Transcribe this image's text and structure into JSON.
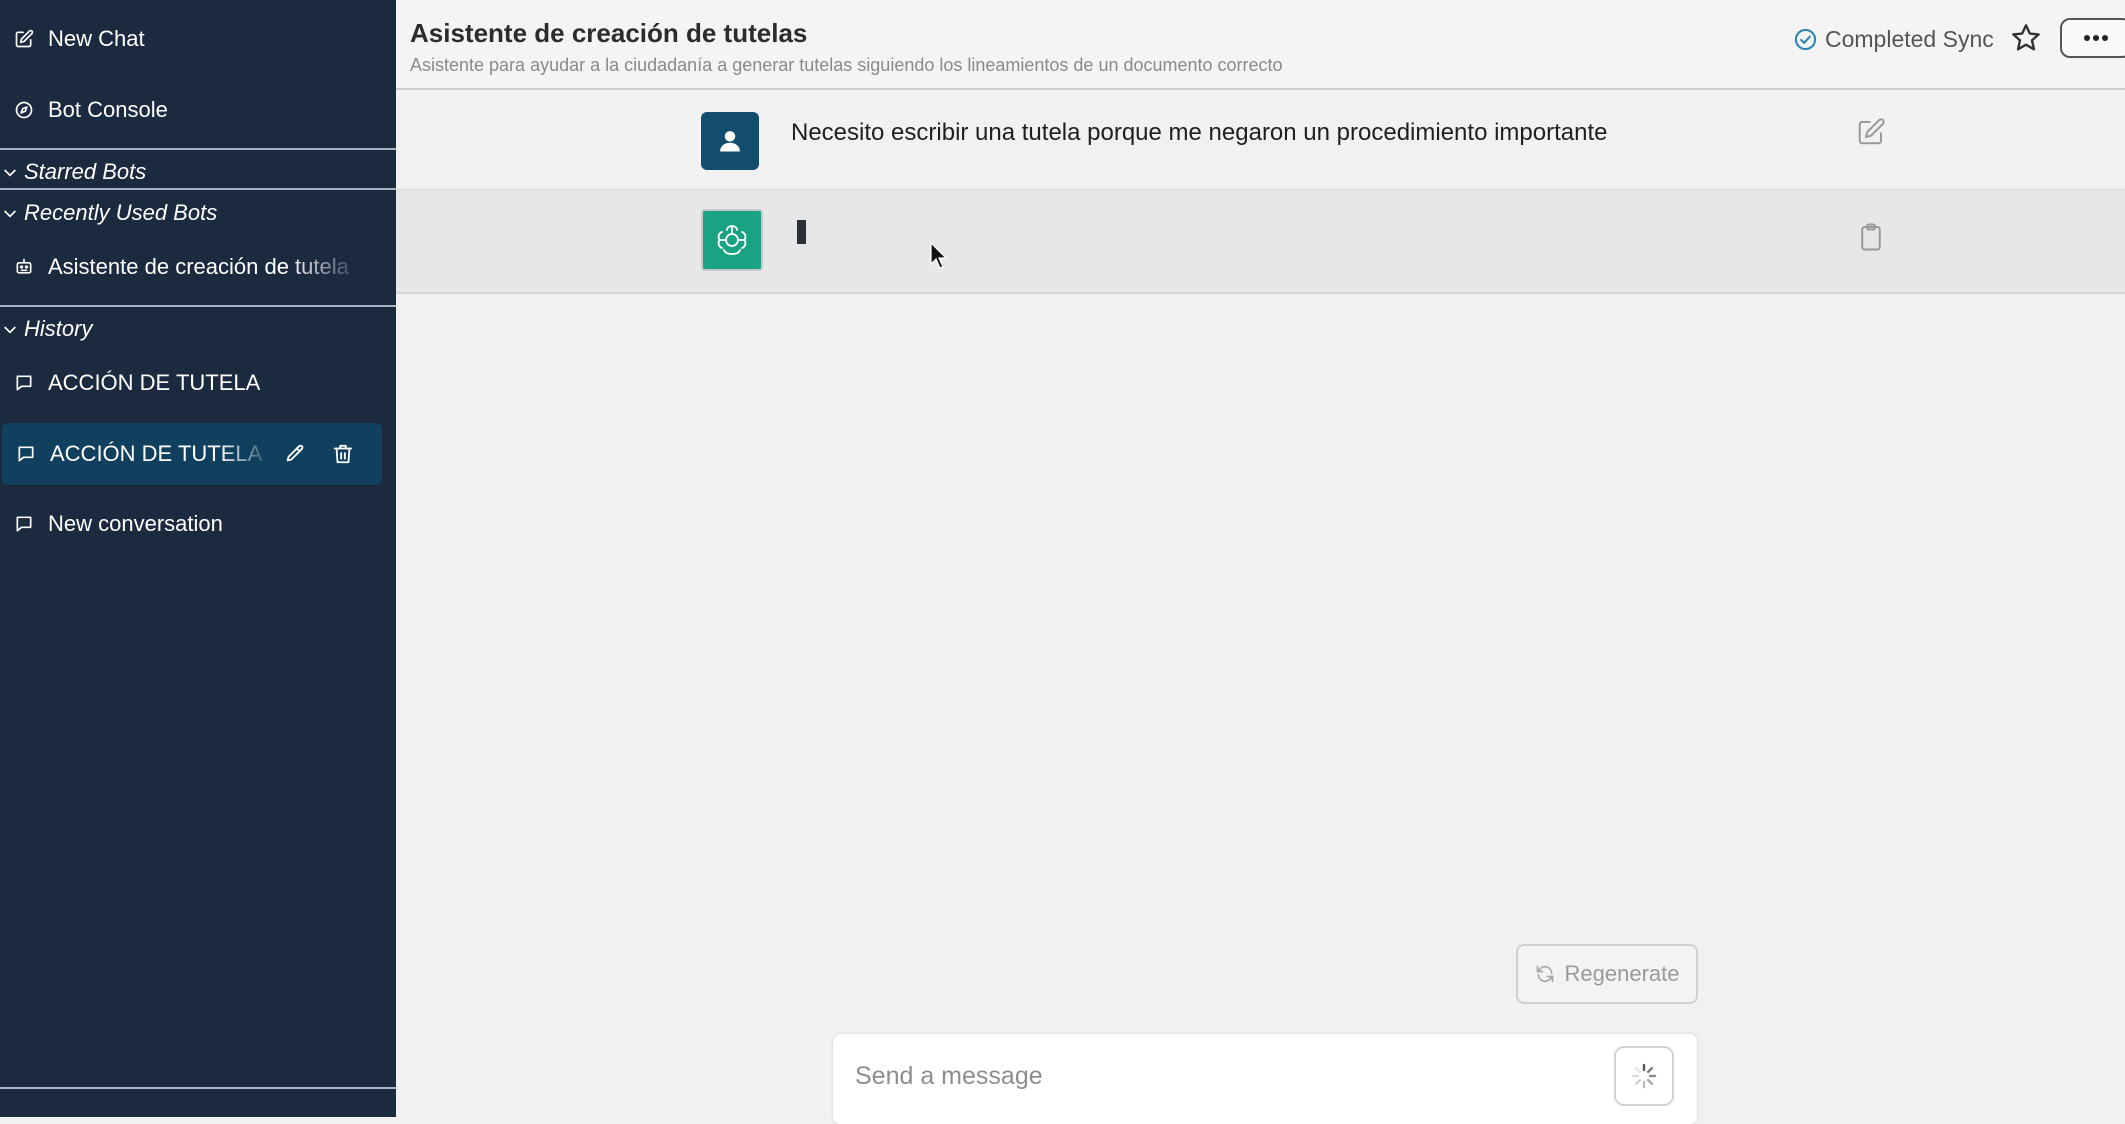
{
  "sidebar": {
    "new_chat": "New Chat",
    "bot_console": "Bot Console",
    "starred_section": "Starred Bots",
    "recent_section": "Recently Used Bots",
    "recent_bots": [
      {
        "label": "Asistente de creación de tutela"
      }
    ],
    "history_section": "History",
    "history": [
      {
        "label": "ACCIÓN DE TUTELA"
      },
      {
        "label": "ACCIÓN DE TUTELA",
        "active": true
      },
      {
        "label": "New conversation"
      }
    ]
  },
  "header": {
    "title": "Asistente de creación de tutelas",
    "subtitle": "Asistente para ayudar a la ciudadanía a generar tutelas siguiendo los lineamientos de un documento correcto",
    "sync_status": "Completed Sync"
  },
  "messages": [
    {
      "role": "user",
      "text": "Necesito escribir una tutela porque me negaron un procedimiento importante"
    },
    {
      "role": "bot",
      "text": ""
    }
  ],
  "composer": {
    "regenerate_label": "Regenerate",
    "placeholder": "Send a message"
  },
  "colors": {
    "sidebar_bg": "#1c2a3f",
    "active_item_bg": "#10405e",
    "user_avatar": "#124d6d",
    "bot_avatar": "#19a383",
    "sync_icon": "#2f86b3"
  },
  "icons": {
    "new_chat": "edit-square-icon",
    "bot_console": "compass-icon",
    "recent_bot": "robot-icon",
    "history_item": "chat-bubble-icon",
    "row_edit": "pencil-icon",
    "row_delete": "trash-icon",
    "sync": "check-circle-icon",
    "star": "star-icon",
    "more": "ellipsis-icon",
    "user_msg_action": "edit-square-icon",
    "bot_msg_action": "clipboard-icon",
    "regenerate": "refresh-icon",
    "send": "spinner-icon"
  }
}
